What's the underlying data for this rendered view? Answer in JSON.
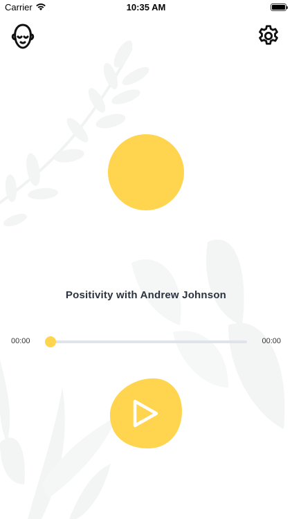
{
  "status_bar": {
    "carrier": "Carrier",
    "time": "10:35 AM",
    "wifi_icon": "wifi-icon",
    "battery_icon": "battery-icon"
  },
  "header": {
    "profile_icon": "meditating-head-icon",
    "settings_icon": "gear-icon"
  },
  "player": {
    "title": "Positivity with Andrew Johnson",
    "elapsed": "00:00",
    "total": "00:00",
    "progress": 0,
    "play_icon": "play-icon"
  },
  "colors": {
    "accent": "#ffd54f",
    "track": "#dfe4ea",
    "text": "#2b3340",
    "decor": "#f2f3f3"
  }
}
